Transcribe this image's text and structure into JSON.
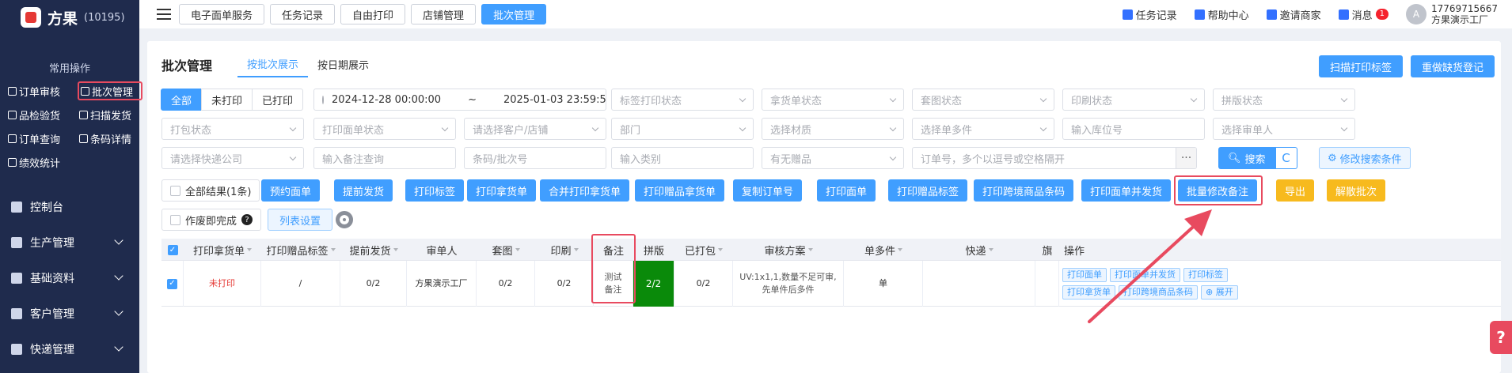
{
  "brand": {
    "name": "方果",
    "id": "(10195)"
  },
  "sidebar": {
    "section_title": "常用操作",
    "quick": [
      "订单审核",
      "批次管理",
      "品检验货",
      "扫描发货",
      "订单查询",
      "条码详情",
      "绩效统计"
    ],
    "menu": [
      "控制台",
      "生产管理",
      "基础资料",
      "客户管理",
      "快递管理"
    ]
  },
  "topbar": {
    "tabs": [
      "电子面单服务",
      "任务记录",
      "自由打印",
      "店铺管理",
      "批次管理"
    ],
    "right": {
      "task": "任务记录",
      "help": "帮助中心",
      "invite": "邀请商家",
      "msg": "消息",
      "msg_count": "1",
      "avatar": "A",
      "phone": "17769715667",
      "factory": "方果演示工厂"
    }
  },
  "page": {
    "title": "批次管理",
    "view_tabs": [
      "按批次展示",
      "按日期展示"
    ],
    "scan_print": "扫描打印标签",
    "redo_shortage": "重做缺货登记"
  },
  "filters": {
    "status_seg": [
      "全部",
      "未打印",
      "已打印"
    ],
    "date_start": "2024-12-28 00:00:00",
    "date_sep": "~",
    "date_end": "2025-01-03 23:59:59",
    "row1": [
      "标签打印状态",
      "拿货单状态",
      "套图状态",
      "印刷状态",
      "拼版状态"
    ],
    "row2": [
      "打包状态",
      "打印面单状态",
      "请选择客户/店铺",
      "部门",
      "选择材质",
      "选择单多件",
      "输入库位号",
      "选择审单人"
    ],
    "row3": [
      "请选择快递公司",
      "输入备注查询",
      "条码/批次号",
      "输入类别",
      "有无赠品",
      "订单号，多个以逗号或空格隔开"
    ],
    "dots": "···",
    "search": "搜索",
    "refresh": "C",
    "modify": "修改搜索条件"
  },
  "actions": {
    "all_results": "全部结果(1条)",
    "buttons": [
      "预约面单",
      "提前发货",
      "打印标签",
      "打印拿货单",
      "合并打印拿货单",
      "打印赠品拿货单",
      "复制订单号",
      "打印面单",
      "打印赠品标签",
      "打印跨境商品条码",
      "打印面单并发货",
      "批量修改备注"
    ],
    "warn_buttons": [
      "导出",
      "解散批次"
    ],
    "void_done": "作废即完成",
    "help": "?",
    "list_settings": "列表设置"
  },
  "table": {
    "headers": [
      "打印拿货单",
      "打印赠品标签",
      "提前发货",
      "审单人",
      "套图",
      "印刷",
      "备注",
      "拼版",
      "已打包",
      "审核方案",
      "单多件",
      "快递",
      "旗",
      "操作"
    ],
    "row": {
      "print_pick": "未打印",
      "gift_label": "/",
      "early_ship": "0/2",
      "reviewer": "方果演示工厂",
      "suite": "0/2",
      "print": "0/2",
      "remark": "测试备注",
      "imposition": "2/2",
      "packed": "0/2",
      "scheme": "UV:1x1,1,数量不足可审,先单件后多件",
      "single_multi": "单",
      "express": "",
      "ops": [
        "打印面单",
        "打印面单并发货",
        "打印标签",
        "打印拿货单",
        "打印跨境商品条码",
        "⊕ 展开"
      ]
    }
  },
  "help_float": "?",
  "colors": {
    "primary": "#409eff",
    "sidebar": "#1f2b4d",
    "warn": "#f7ba1e",
    "annot": "#e84a5f",
    "green": "#0a8a0a"
  }
}
